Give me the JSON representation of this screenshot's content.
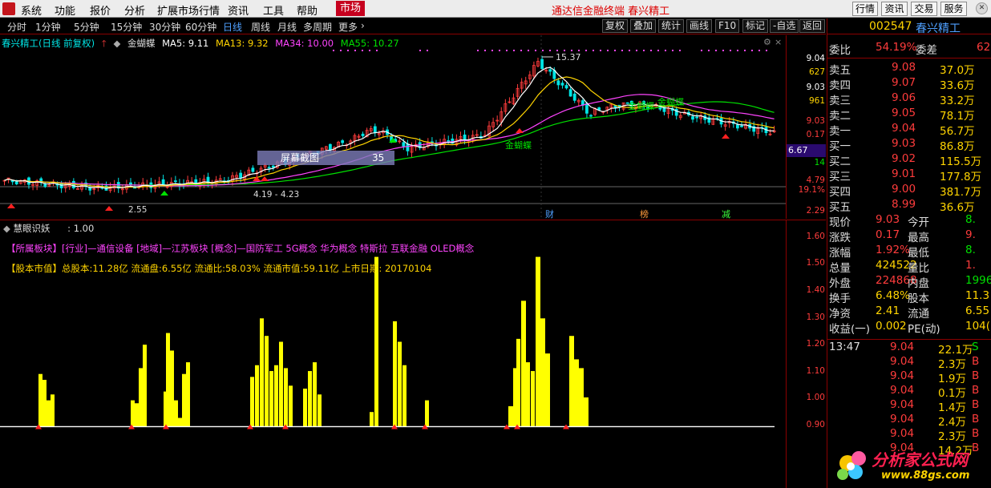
{
  "menu": {
    "items": [
      "系统",
      "功能",
      "报价",
      "分析",
      "扩展市场行情",
      "资讯",
      "工具",
      "帮助"
    ],
    "market": "市场",
    "app_title": "通达信金融终端  春兴精工",
    "right_buttons": [
      "行情",
      "资讯",
      "交易",
      "服务"
    ]
  },
  "periods": {
    "tabs": [
      "分时",
      "1分钟",
      "5分钟",
      "15分钟",
      "30分钟",
      "60分钟",
      "日线",
      "周线",
      "月线",
      "多周期",
      "更多"
    ],
    "selected": "日线",
    "tools": [
      "复权",
      "叠加",
      "统计",
      "画线",
      "F10",
      "标记",
      "-自选",
      "返回"
    ]
  },
  "main_chart": {
    "stock_label": "春兴精工(日线 前复权)",
    "indicator_name": "金蝴蝶",
    "ma": [
      {
        "label": "MA5: 9.11",
        "color": "#ffffff"
      },
      {
        "label": "MA13: 9.32",
        "color": "#ffd400"
      },
      {
        "label": "MA34: 10.00",
        "color": "#ff44ff"
      },
      {
        "label": "MA55: 10.27",
        "color": "#00e000"
      }
    ],
    "peak_label": "15.37",
    "range_label": "4.19 - 4.23",
    "low_label": "2.55",
    "butterfly_label": "金蝴蝶",
    "screenshot_box": {
      "text": "屏幕截图",
      "value": "35"
    },
    "event_markers": [
      {
        "text": "财",
        "color": "#4fa0ff"
      },
      {
        "text": "榜",
        "color": "#ff9a3c"
      },
      {
        "text": "减",
        "color": "#3cff3c"
      }
    ],
    "price_axis": [
      {
        "text": "9.04",
        "color": "#ffffff"
      },
      {
        "text": "627",
        "color": "#ffd400"
      },
      {
        "text": "9.03",
        "color": "#ffffff"
      },
      {
        "text": "961",
        "color": "#ffd400"
      },
      {
        "text": "9.03",
        "color": "#ff3c3c"
      },
      {
        "text": "0.17",
        "color": "#ff3c3c"
      },
      {
        "text": "14",
        "color": "#00e000"
      },
      {
        "text": "4.79",
        "color": "#ff3c3c"
      },
      {
        "text": "19.1%",
        "color": "#ff3c3c"
      },
      {
        "text": "2.29",
        "color": "#ff3c3c"
      }
    ],
    "current_price_tag": "6.67"
  },
  "lower_chart": {
    "title": "慧眼识妖",
    "value": ": 1.00",
    "sector_text": "【所属板块】[行业]—通信设备 [地域]—江苏板块 [概念]—国防军工 5G概念 华为概念 特斯拉 互联金融 OLED概念",
    "market_value_text": "【股本市值】总股本:11.28亿 流通盘:6.55亿 流通比:58.03% 流通市值:59.11亿 上市日期: 20170104",
    "axis_ticks": [
      "1.60",
      "1.50",
      "1.40",
      "1.30",
      "1.20",
      "1.10",
      "1.00",
      "0.90"
    ]
  },
  "side_panel": {
    "code": "002547",
    "name": "春兴精工",
    "commission": {
      "label1": "委比",
      "val1": "54.19%",
      "label2": "委差",
      "val2": "62"
    },
    "sell": [
      {
        "label": "卖五",
        "price": "9.08",
        "vol": "37.0万"
      },
      {
        "label": "卖四",
        "price": "9.07",
        "vol": "33.6万"
      },
      {
        "label": "卖三",
        "price": "9.06",
        "vol": "33.2万"
      },
      {
        "label": "卖二",
        "price": "9.05",
        "vol": "78.1万"
      },
      {
        "label": "卖一",
        "price": "9.04",
        "vol": "56.7万"
      }
    ],
    "buy": [
      {
        "label": "买一",
        "price": "9.03",
        "vol": "86.8万"
      },
      {
        "label": "买二",
        "price": "9.02",
        "vol": "115.5万"
      },
      {
        "label": "买三",
        "price": "9.01",
        "vol": "177.8万"
      },
      {
        "label": "买四",
        "price": "9.00",
        "vol": "381.7万"
      },
      {
        "label": "买五",
        "price": "8.99",
        "vol": "36.6万"
      }
    ],
    "stats": [
      {
        "l1": "现价",
        "v1": "9.03",
        "c1": "#ff3c3c",
        "l2": "今开",
        "v2": "8.",
        "c2": "#00e000"
      },
      {
        "l1": "涨跌",
        "v1": "0.17",
        "c1": "#ff3c3c",
        "l2": "最高",
        "v2": "9.",
        "c2": "#ff3c3c"
      },
      {
        "l1": "涨幅",
        "v1": "1.92%",
        "c1": "#ff3c3c",
        "l2": "最低",
        "v2": "8.",
        "c2": "#00e000"
      },
      {
        "l1": "总量",
        "v1": "424522",
        "c1": "#ffd400",
        "l2": "量比",
        "v2": "1.",
        "c2": "#ff3c3c"
      },
      {
        "l1": "外盘",
        "v1": "224868",
        "c1": "#ff3c3c",
        "l2": "内盘",
        "v2": "1996",
        "c2": "#00e000"
      },
      {
        "l1": "换手",
        "v1": "6.48%",
        "c1": "#ffd400",
        "l2": "股本",
        "v2": "11.3",
        "c2": "#ffd400"
      },
      {
        "l1": "净资",
        "v1": "2.41",
        "c1": "#ffd400",
        "l2": "流通",
        "v2": "6.55",
        "c2": "#ffd400"
      },
      {
        "l1": "收益(一)",
        "v1": "0.002",
        "c1": "#ffd400",
        "l2": "PE(动)",
        "v2": "104(",
        "c2": "#ffd400"
      }
    ],
    "ticks": [
      {
        "time": "13:47",
        "price": "9.04",
        "vol": "22.1万",
        "bs": "S"
      },
      {
        "time": "",
        "price": "9.04",
        "vol": "2.3万",
        "bs": "B"
      },
      {
        "time": "",
        "price": "9.04",
        "vol": "1.9万",
        "bs": "B"
      },
      {
        "time": "",
        "price": "9.04",
        "vol": "0.1万",
        "bs": "B"
      },
      {
        "time": "",
        "price": "9.04",
        "vol": "1.4万",
        "bs": "B"
      },
      {
        "time": "",
        "price": "9.04",
        "vol": "2.4万",
        "bs": "B"
      },
      {
        "time": "",
        "price": "9.04",
        "vol": "2.3万",
        "bs": "B"
      },
      {
        "time": "",
        "price": "9.04",
        "vol": "14.2万",
        "bs": "B"
      }
    ]
  },
  "watermark": {
    "title": "分析家公式网",
    "url": "www.88gs.com"
  },
  "chart_data": {
    "type": "bar",
    "title": "慧眼识妖",
    "ylim": [
      0.9,
      1.65
    ],
    "baseline": 1.0,
    "values": [
      1.18,
      1.16,
      1.09,
      1.11,
      1.09,
      1.08,
      1.2,
      1.28,
      1.32,
      1.26,
      1.09,
      1.03,
      1.18,
      1.22,
      1.17,
      1.21,
      1.37,
      1.31,
      1.19,
      1.21,
      1.29,
      1.2,
      1.14,
      1.13,
      1.19,
      1.22,
      1.11,
      1.05,
      1.58,
      1.36,
      1.29,
      1.21,
      1.09,
      1.3,
      1.22,
      1.19
    ]
  }
}
